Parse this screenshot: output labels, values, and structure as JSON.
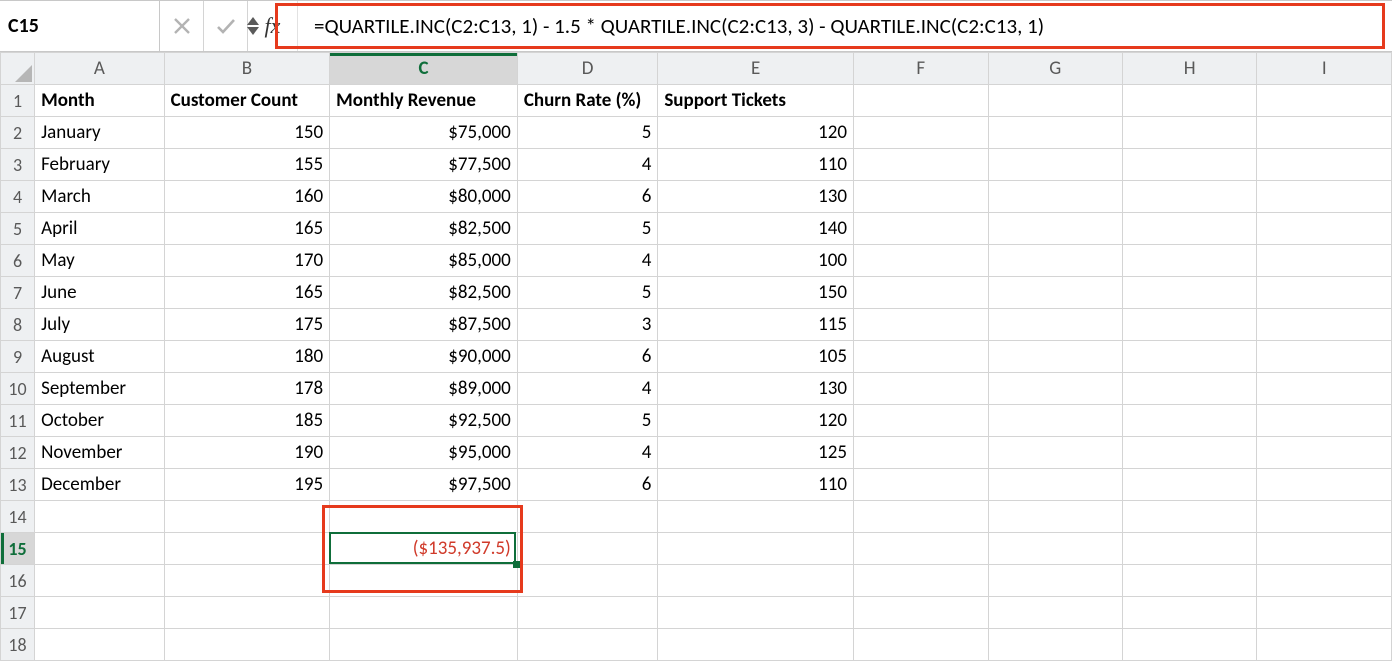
{
  "namebox": {
    "value": "C15"
  },
  "formula_bar": {
    "fx_label": "fx",
    "formula": "=QUARTILE.INC(C2:C13, 1) - 1.5 * QUARTILE.INC(C2:C13, 3) - QUARTILE.INC(C2:C13, 1)"
  },
  "columns": [
    "A",
    "B",
    "C",
    "D",
    "E",
    "F",
    "G",
    "H",
    "I"
  ],
  "row_headers": [
    "1",
    "2",
    "3",
    "4",
    "5",
    "6",
    "7",
    "8",
    "9",
    "10",
    "11",
    "12",
    "13",
    "14",
    "15",
    "16",
    "17",
    "18"
  ],
  "headers": {
    "A": "Month",
    "B": "Customer Count",
    "C": "Monthly Revenue",
    "D": "Churn Rate (%)",
    "E": "Support Tickets"
  },
  "rows": [
    {
      "A": "January",
      "B": "150",
      "C": "$75,000",
      "D": "5",
      "E": "120"
    },
    {
      "A": "February",
      "B": "155",
      "C": "$77,500",
      "D": "4",
      "E": "110"
    },
    {
      "A": "March",
      "B": "160",
      "C": "$80,000",
      "D": "6",
      "E": "130"
    },
    {
      "A": "April",
      "B": "165",
      "C": "$82,500",
      "D": "5",
      "E": "140"
    },
    {
      "A": "May",
      "B": "170",
      "C": "$85,000",
      "D": "4",
      "E": "100"
    },
    {
      "A": "June",
      "B": "165",
      "C": "$82,500",
      "D": "5",
      "E": "150"
    },
    {
      "A": "July",
      "B": "175",
      "C": "$87,500",
      "D": "3",
      "E": "115"
    },
    {
      "A": "August",
      "B": "180",
      "C": "$90,000",
      "D": "6",
      "E": "105"
    },
    {
      "A": "September",
      "B": "178",
      "C": "$89,000",
      "D": "4",
      "E": "130"
    },
    {
      "A": "October",
      "B": "185",
      "C": "$92,500",
      "D": "5",
      "E": "120"
    },
    {
      "A": "November",
      "B": "190",
      "C": "$95,000",
      "D": "4",
      "E": "125"
    },
    {
      "A": "December",
      "B": "195",
      "C": "$97,500",
      "D": "6",
      "E": "110"
    }
  ],
  "result_cell": {
    "ref": "C15",
    "display": "($135,937.5)"
  },
  "selection": {
    "active": "C15",
    "row": 15,
    "col": "C"
  }
}
